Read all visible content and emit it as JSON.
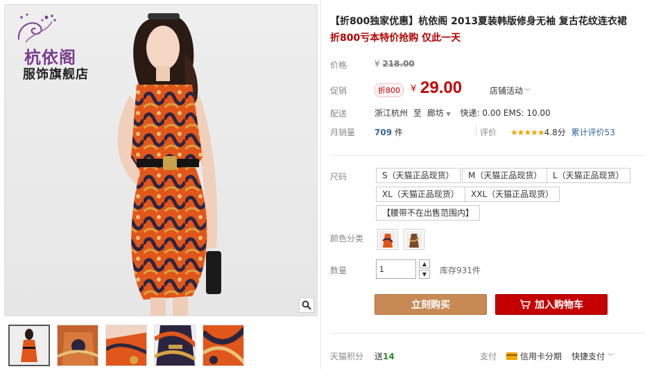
{
  "store": {
    "brand": "杭依阁",
    "store_name": "服饰旗舰店"
  },
  "gallery": {
    "thumbnail_count": 5,
    "zoom_icon": "magnifier-icon"
  },
  "product": {
    "title": "【折800独家优惠】杭依阁 2013夏装韩版修身无袖 复古花纹连衣裙",
    "promo": "折800亏本特价抢购 仅此一天"
  },
  "price": {
    "label": "价格",
    "currency": "¥",
    "original": "218.00",
    "promo_label": "促销",
    "tag": "折800",
    "current": "29.00",
    "shop_activity": "店铺活动"
  },
  "shipping": {
    "label": "配送",
    "from": "浙江杭州",
    "to_word": "至",
    "destination": "廊坊",
    "fees": "快递: 0.00 EMS: 10.00"
  },
  "sales": {
    "label": "月销量",
    "count": "709",
    "unit": "件",
    "rating_label": "评价",
    "stars": "★★★★★",
    "score": "4.8分",
    "review_link": "累计评价53"
  },
  "sizes": {
    "label": "尺码",
    "options": [
      "S（天猫正品现货）",
      "M（天猫正品现货）",
      "L（天猫正品现货）",
      "XL（天猫正品现货）",
      "XXL（天猫正品现货）",
      "【腰带不在出售范围内】"
    ]
  },
  "colors": {
    "label": "颜色分类"
  },
  "quantity": {
    "label": "数量",
    "value": "1",
    "stock": "库存931件"
  },
  "actions": {
    "buy_now": "立刻购买",
    "add_to_cart": "加入购物车"
  },
  "footer": {
    "points_label": "天猫积分",
    "points_prefix": "送",
    "points_value": "14",
    "pay_label": "支付",
    "credit_card": "信用卡分期",
    "quick_pay": "快捷支付"
  },
  "colors_theme": {
    "price_red": "#c40000",
    "buy_brown": "#c88a55",
    "link_blue": "#336699"
  }
}
